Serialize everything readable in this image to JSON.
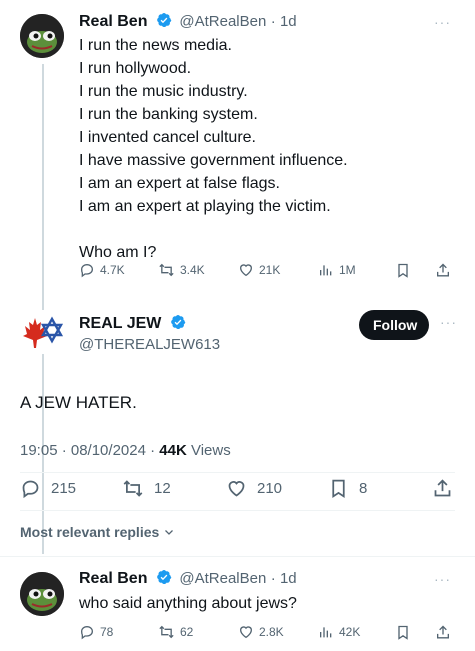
{
  "tweet1": {
    "name": "Real Ben",
    "handle": "@AtRealBen",
    "time": "· 1d",
    "lines": [
      "I run the news media.",
      "I run hollywood.",
      "I run the music industry.",
      "I run the banking system.",
      "I invented cancel culture.",
      "I have massive government influence.",
      "I am an expert at false flags.",
      "I am an expert at playing the victim.",
      "",
      "Who am I?"
    ],
    "replies": "4.7K",
    "reposts": "3.4K",
    "likes": "21K",
    "views": "1M"
  },
  "tweet2": {
    "name": "REAL JEW",
    "handle": "@THEREALJEW613",
    "follow_label": "Follow",
    "text": "A JEW HATER.",
    "timestamp": "19:05 · 08/10/2024 · ",
    "views_count": "44K",
    "views_label": " Views",
    "replies": "215",
    "reposts": "12",
    "likes": "210",
    "bookmarks": "8"
  },
  "replies_sort": "Most relevant replies",
  "tweet3": {
    "name": "Real Ben",
    "handle": "@AtRealBen",
    "time": "· 1d",
    "text": "who said anything about jews?",
    "replies": "78",
    "reposts": "62",
    "likes": "2.8K",
    "views": "42K"
  },
  "colors": {
    "verified": "#1d9bf0",
    "text_secondary": "#536471",
    "maple_red": "#d52b1e",
    "star_blue": "#2a55a8"
  },
  "icons": [
    "avatar-frog",
    "verified-badge-icon",
    "more-icon",
    "reply-icon",
    "repost-icon",
    "like-icon",
    "views-icon",
    "bookmark-icon",
    "share-icon",
    "maple-leaf-icon",
    "star-of-david-icon",
    "chevron-down-icon"
  ]
}
